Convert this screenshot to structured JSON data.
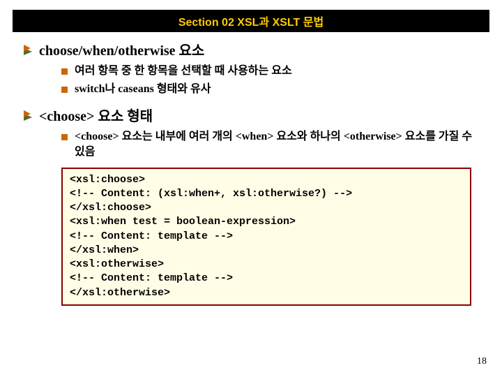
{
  "header": {
    "title": "Section 02 XSL과 XSLT 문법"
  },
  "content": {
    "item1": {
      "title": "choose/when/otherwise 요소",
      "sub1": "여러 항목 중 한 항목을 선택할 때 사용하는 요소",
      "sub2": "switch나 caseans 형태와 유사"
    },
    "item2": {
      "title": "<choose> 요소 형태",
      "sub1": "<choose> 요소는 내부에 여러 개의 <when> 요소와 하나의 <otherwise> 요소를 가질 수 있음"
    }
  },
  "code": "<xsl:choose>\n<!-- Content: (xsl:when+, xsl:otherwise?) -->\n</xsl:choose>\n<xsl:when test = boolean-expression>\n<!-- Content: template -->\n</xsl:when>\n<xsl:otherwise>\n<!-- Content: template -->\n</xsl:otherwise>",
  "page_number": "18"
}
